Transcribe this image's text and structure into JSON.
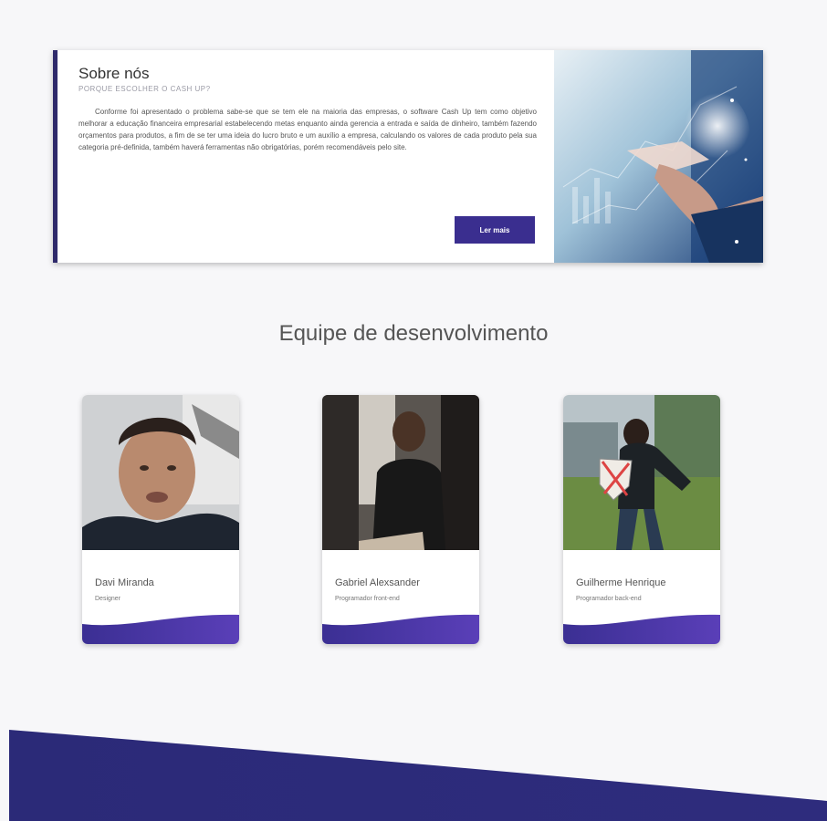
{
  "about": {
    "title": "Sobre nós",
    "subtitle": "PORQUE ESCOLHER O CASH UP?",
    "body": "Conforme foi apresentado o problema sabe-se que se tem ele na maioria das empresas, o software Cash Up tem como objetivo melhorar a educação financeira empresarial estabelecendo metas enquanto ainda gerencia a entrada e saída de dinheiro, também fazendo orçamentos para produtos, a fim de se ter uma ideia do lucro bruto e um auxílio a empresa, calculando os valores de cada produto pela sua categoria pré-definida, também haverá ferramentas não obrigatórias, porém recomendáveis pelo site.",
    "read_more": "Ler mais",
    "image_icon": "finance-chart-hand-image"
  },
  "team": {
    "title": "Equipe de desenvolvimento",
    "members": [
      {
        "name": "Davi Miranda",
        "role": "Designer"
      },
      {
        "name": "Gabriel Alexsander",
        "role": "Programador front-end"
      },
      {
        "name": "Guilherme Henrique",
        "role": "Programador back-end"
      }
    ]
  },
  "colors": {
    "accent": "#3a2e8f",
    "card_border": "#2f2a6b",
    "wave_start": "#2b2a78",
    "wave_end": "#4a35a8",
    "background": "#f7f7f9"
  }
}
